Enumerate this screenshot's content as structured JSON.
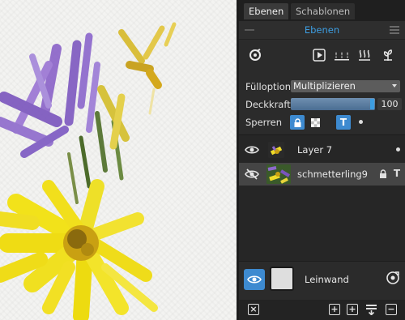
{
  "tabs": [
    "Ebenen",
    "Schablonen"
  ],
  "panel_title": "Ebenen",
  "toolbar_icons": [
    "brush-settings-icon",
    "playback-icon",
    "drops-icon",
    "heat-icon",
    "plant-icon"
  ],
  "fill_option": {
    "label": "Fülloption",
    "value": "Multiplizieren"
  },
  "opacity": {
    "label": "Deckkraft",
    "value": "100",
    "fraction": 1.0
  },
  "locks": {
    "label": "Sperren"
  },
  "layers": [
    {
      "name": "Layer 7",
      "selected": false
    },
    {
      "name": "schmetterling9",
      "selected": true
    }
  ],
  "canvas_layer": {
    "name": "Leinwand"
  },
  "colors": {
    "accent": "#3d9de0",
    "panel": "#2b2b2b"
  }
}
